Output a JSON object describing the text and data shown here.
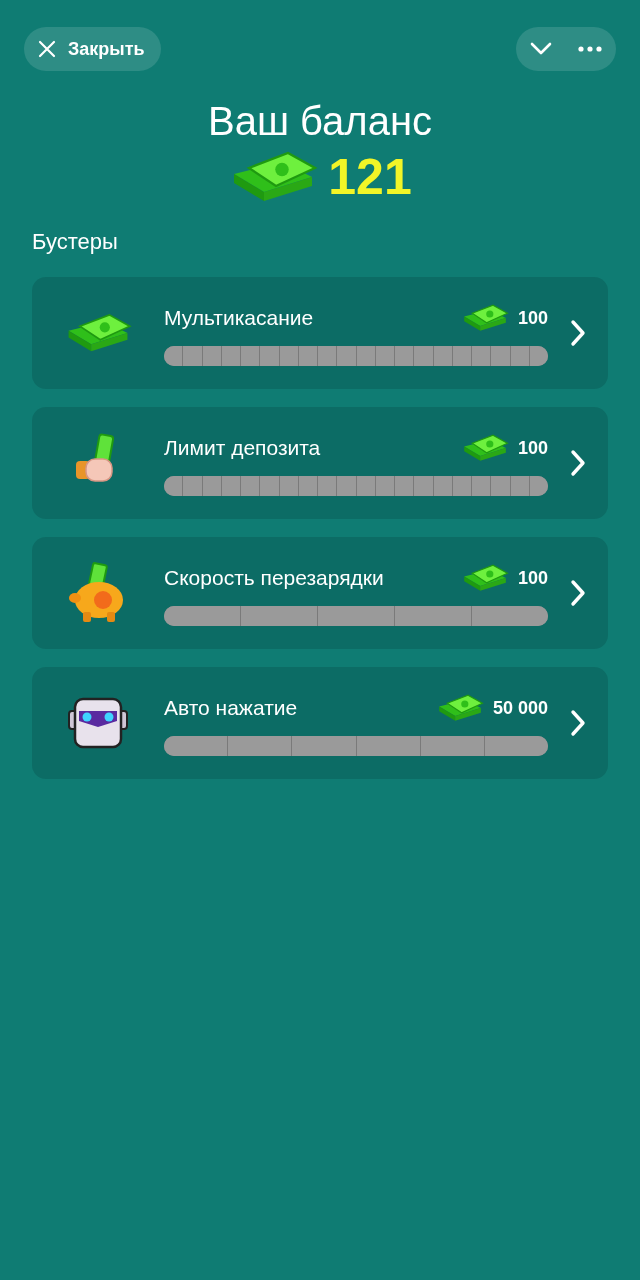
{
  "header": {
    "close_label": "Закрыть"
  },
  "balance": {
    "title": "Ваш баланс",
    "amount": "121"
  },
  "section_title": "Бустеры",
  "boosters": [
    {
      "name": "Мультикасание",
      "kind": "cash",
      "price": "100",
      "segments": [
        {
          "filled": false
        },
        {
          "filled": false
        },
        {
          "filled": false
        },
        {
          "filled": false
        },
        {
          "filled": false
        },
        {
          "filled": false
        },
        {
          "filled": false
        },
        {
          "filled": false
        },
        {
          "filled": false
        },
        {
          "filled": false
        },
        {
          "filled": false
        },
        {
          "filled": false
        },
        {
          "filled": false
        },
        {
          "filled": false
        },
        {
          "filled": false
        },
        {
          "filled": false
        },
        {
          "filled": false
        },
        {
          "filled": false
        },
        {
          "filled": false
        },
        {
          "filled": false
        }
      ]
    },
    {
      "name": "Лимит депозита",
      "kind": "hand",
      "price": "100",
      "segments": [
        {
          "filled": false
        },
        {
          "filled": false
        },
        {
          "filled": false
        },
        {
          "filled": false
        },
        {
          "filled": false
        },
        {
          "filled": false
        },
        {
          "filled": false
        },
        {
          "filled": false
        },
        {
          "filled": false
        },
        {
          "filled": false
        },
        {
          "filled": false
        },
        {
          "filled": false
        },
        {
          "filled": false
        },
        {
          "filled": false
        },
        {
          "filled": false
        },
        {
          "filled": false
        },
        {
          "filled": false
        },
        {
          "filled": false
        },
        {
          "filled": false
        },
        {
          "filled": false
        }
      ]
    },
    {
      "name": "Скорость перезарядки",
      "kind": "piggy",
      "price": "100",
      "segments": [
        {
          "filled": false
        },
        {
          "filled": false
        },
        {
          "filled": false
        },
        {
          "filled": false
        },
        {
          "filled": false
        }
      ]
    },
    {
      "name": "Авто нажатие",
      "kind": "robot",
      "price": "50 000",
      "segments": [
        {
          "filled": false
        },
        {
          "filled": false
        },
        {
          "filled": false
        },
        {
          "filled": false
        },
        {
          "filled": false
        },
        {
          "filled": false
        }
      ]
    }
  ]
}
